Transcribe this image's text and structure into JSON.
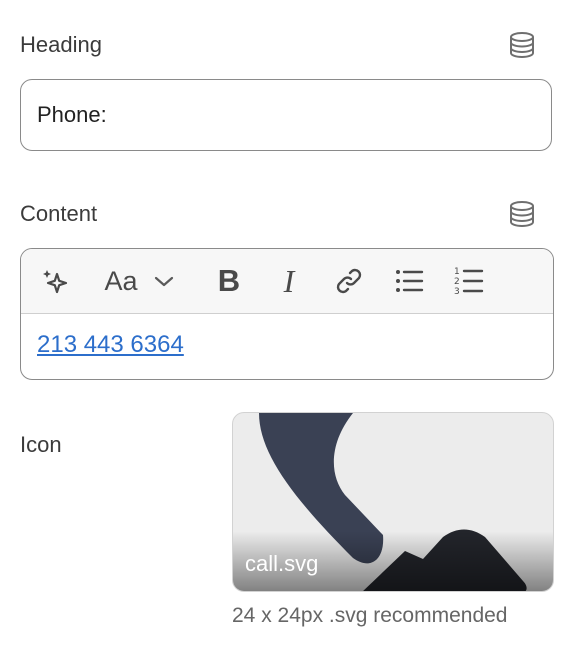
{
  "heading": {
    "label": "Heading",
    "value": "Phone:",
    "dynamic_source_icon": "database-icon"
  },
  "content": {
    "label": "Content",
    "dynamic_source_icon": "database-icon",
    "toolbar": {
      "ai_icon": "sparkle-icon",
      "font_label": "Aa",
      "font_dropdown_icon": "chevron-down-icon",
      "bold_label": "B",
      "italic_label": "I",
      "link_icon": "link-icon",
      "bullet_list_icon": "bullet-list-icon",
      "numbered_list_icon": "numbered-list-icon"
    },
    "text": "213 443 6364",
    "link_color": "#2c6ecb"
  },
  "icon_field": {
    "label": "Icon",
    "filename": "call.svg",
    "hint": "24 x 24px .svg recommended",
    "preview_icon": "phone-icon"
  }
}
